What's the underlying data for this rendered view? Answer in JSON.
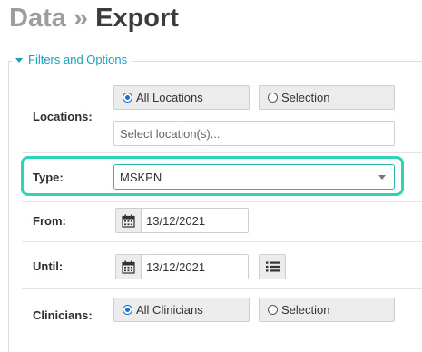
{
  "header": {
    "title_part1": "Data",
    "separator": "»",
    "title_part2": "Export"
  },
  "filters": {
    "legend": "Filters and Options",
    "locations": {
      "label": "Locations:",
      "option_all": "All Locations",
      "option_selection": "Selection",
      "selected": "all",
      "select_placeholder": "Select location(s)..."
    },
    "type": {
      "label": "Type:",
      "value": "MSKPN"
    },
    "from": {
      "label": "From:",
      "value": "13/12/2021"
    },
    "until": {
      "label": "Until:",
      "value": "13/12/2021"
    },
    "clinicians": {
      "label": "Clinicians:",
      "option_all": "All Clinicians",
      "option_selection": "Selection",
      "selected": "all"
    }
  },
  "icons": {
    "calendar": "calendar-icon",
    "list": "list-icon",
    "dropdown": "chevron-down-icon",
    "collapse": "caret-down-icon"
  },
  "colors": {
    "accent": "#1a9fba",
    "highlight": "#2fd3b5",
    "radio_selected": "#1a72d8"
  }
}
